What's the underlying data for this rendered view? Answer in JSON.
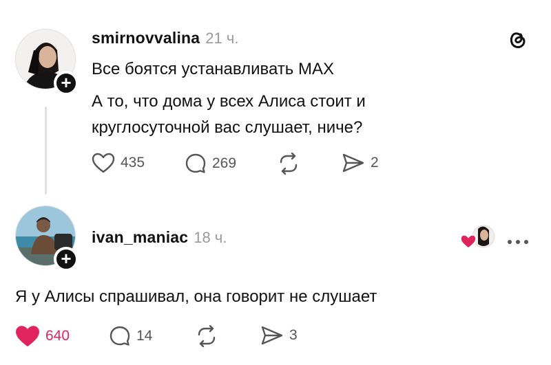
{
  "post": {
    "username": "smirnovvalina",
    "time": "21 ч.",
    "line1": "Все боятся устанавливать MAX",
    "line2": "А то, что дома у всех Алиса стоит и",
    "line3": "круглосуточной вас слушает, ниче?",
    "likes": "435",
    "comments": "269",
    "shares": "2",
    "icons": [
      "threads-logo-icon",
      "heart-icon",
      "comment-icon",
      "repost-icon",
      "share-icon",
      "follow-plus-icon"
    ]
  },
  "reply": {
    "username": "ivan_maniac",
    "time": "18 ч.",
    "text": "Я у Алисы спрашивал, она говорит не слушает",
    "likes": "640",
    "comments": "14",
    "shares": "3",
    "liked": true,
    "like_color": "#e0245e",
    "icons": [
      "liked-by-author-icon",
      "more-options-icon",
      "heart-filled-icon",
      "comment-icon",
      "repost-icon",
      "share-icon"
    ]
  }
}
